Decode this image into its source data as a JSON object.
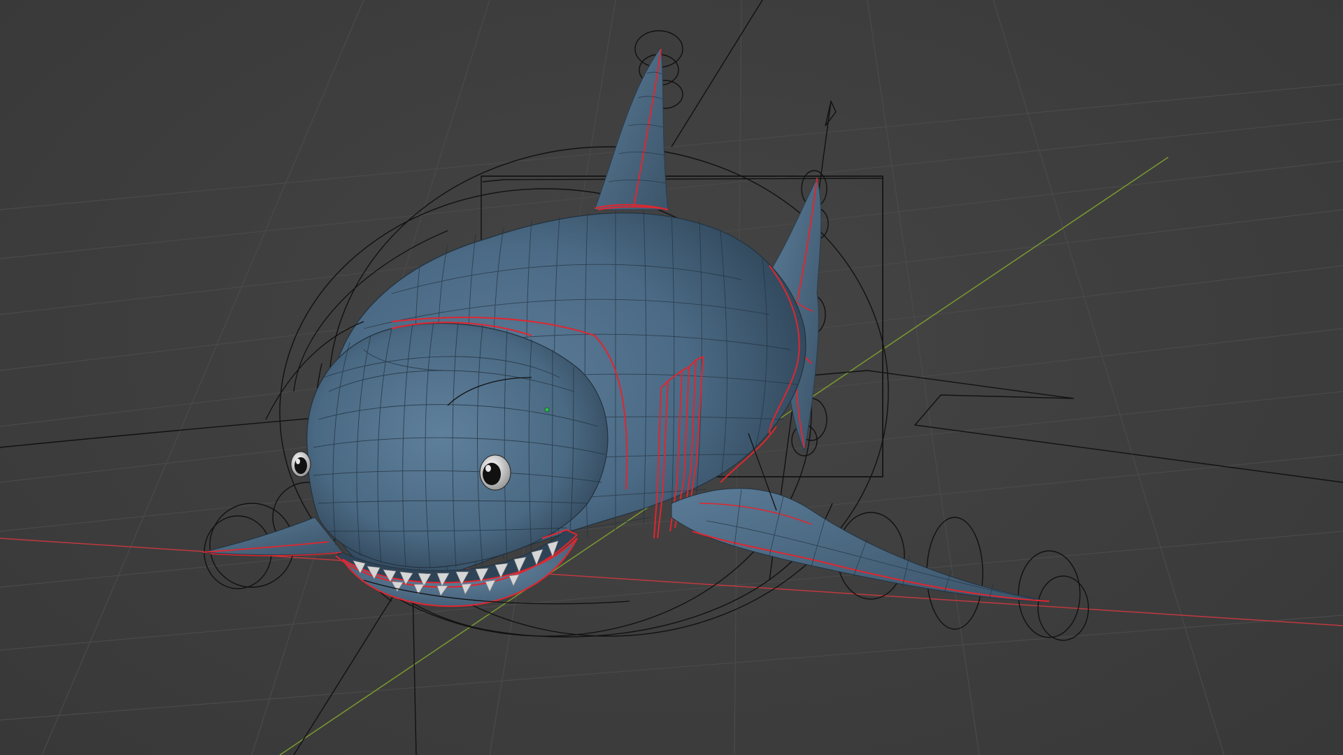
{
  "viewport": {
    "label": "3d-viewport"
  },
  "colors": {
    "background": "#3d3d3d",
    "grid_line": "#4a4a4a",
    "x_axis": "#c0393f",
    "y_axis": "#7a9a2e",
    "mesh_fill": "#4d6b85",
    "mesh_dark": "#2c4054",
    "mesh_wire": "#22323f",
    "seam": "#e0262f",
    "rig_wire": "#111111",
    "eye_white": "#e8e8e8",
    "eye_pupil": "#111111",
    "teeth": "#d6d6d6",
    "origin_dot": "#2fbf4a"
  },
  "icons": {
    "origin": "object-origin-icon"
  }
}
